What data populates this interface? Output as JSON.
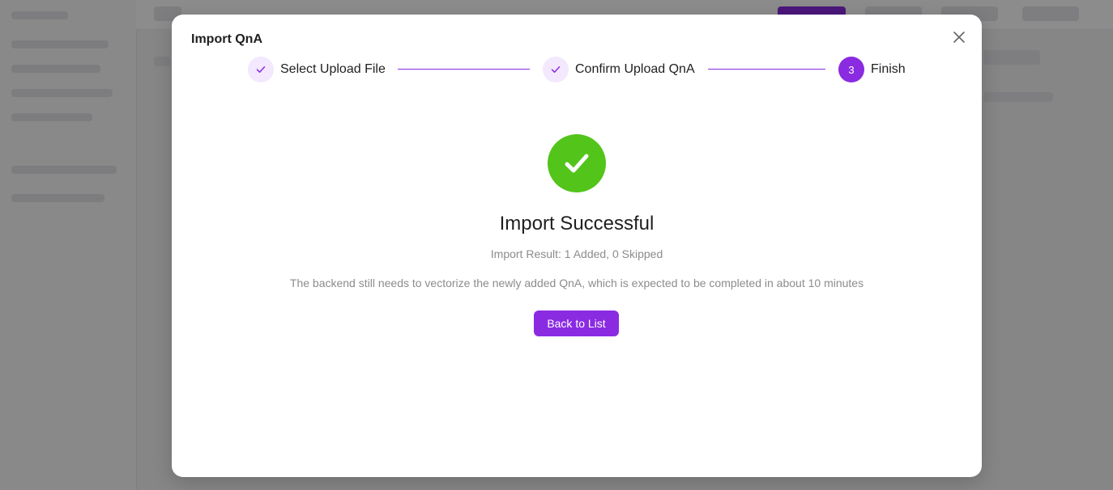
{
  "modal": {
    "title": "Import QnA",
    "close_icon": "close-icon"
  },
  "steps": [
    {
      "label": "Select Upload File",
      "status": "done",
      "icon": "check-icon"
    },
    {
      "label": "Confirm Upload QnA",
      "status": "done",
      "icon": "check-icon"
    },
    {
      "label": "Finish",
      "status": "active",
      "number": "3"
    }
  ],
  "result": {
    "icon": "success-check-icon",
    "title": "Import Successful",
    "subtitle": "Import Result: 1 Added, 0 Skipped",
    "note": "The backend still needs to vectorize the newly added QnA, which is expected to be completed in about 10 minutes",
    "button_label": "Back to List"
  },
  "colors": {
    "accent": "#8a2be2",
    "success": "#52c41a",
    "step_done_bg": "#f3e8fd",
    "muted_text": "#8c8c8c"
  }
}
